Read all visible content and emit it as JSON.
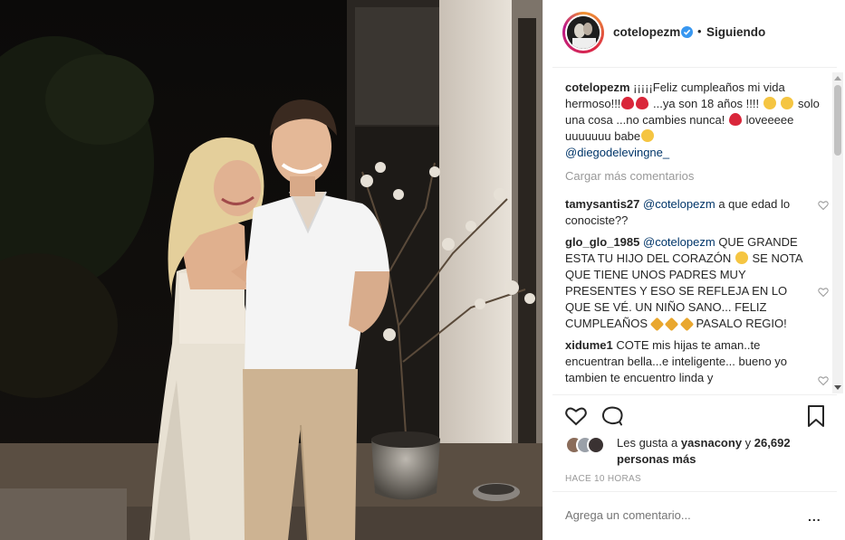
{
  "header": {
    "username": "cotelopezm",
    "separator": "•",
    "follow_label": "Siguiendo"
  },
  "caption": {
    "username": "cotelopezm",
    "text_1": "¡¡¡¡¡Feliz cumpleaños mi vida hermoso!!!",
    "text_2": "...ya son 18 años !!!!",
    "text_3": "solo una cosa ...no cambies nunca!",
    "text_4": "loveeeee uuuuuuu babe",
    "mention": "@diegodelevingne_"
  },
  "load_more": "Cargar más comentarios",
  "comments": [
    {
      "user": "tamysantis27",
      "mention": "@cotelopezm",
      "text": "a que edad lo conociste??"
    },
    {
      "user": "glo_glo_1985",
      "mention": "@cotelopezm",
      "text_1": "QUE GRANDE ESTA TU HIJO DEL CORAZÓN",
      "text_2": "SE NOTA QUE TIENE UNOS PADRES MUY PRESENTES Y ESO SE REFLEJA EN LO QUE SE VÉ. UN NIÑO SANO... FELIZ CUMPLEAÑOS",
      "text_3": "PASALO REGIO!"
    },
    {
      "user": "xidume1",
      "text": "COTE mis hijas te aman..te encuentran bella...e inteligente... bueno yo tambien te encuentro linda y"
    }
  ],
  "likes": {
    "prefix": "Les gusta a",
    "user": "yasnacony",
    "conj": "y",
    "count": "26,692 personas más"
  },
  "timestamp": "HACE 10 HORAS",
  "comment_box": {
    "placeholder": "Agrega un comentario..."
  },
  "more_options": "...",
  "icons": {
    "like": "heart-icon",
    "comment": "comment-icon",
    "save": "bookmark-icon",
    "verified": "verified-badge-icon"
  },
  "colors": {
    "verified": "#3897f0",
    "mention": "#003569",
    "muted": "#999999",
    "text": "#262626"
  }
}
